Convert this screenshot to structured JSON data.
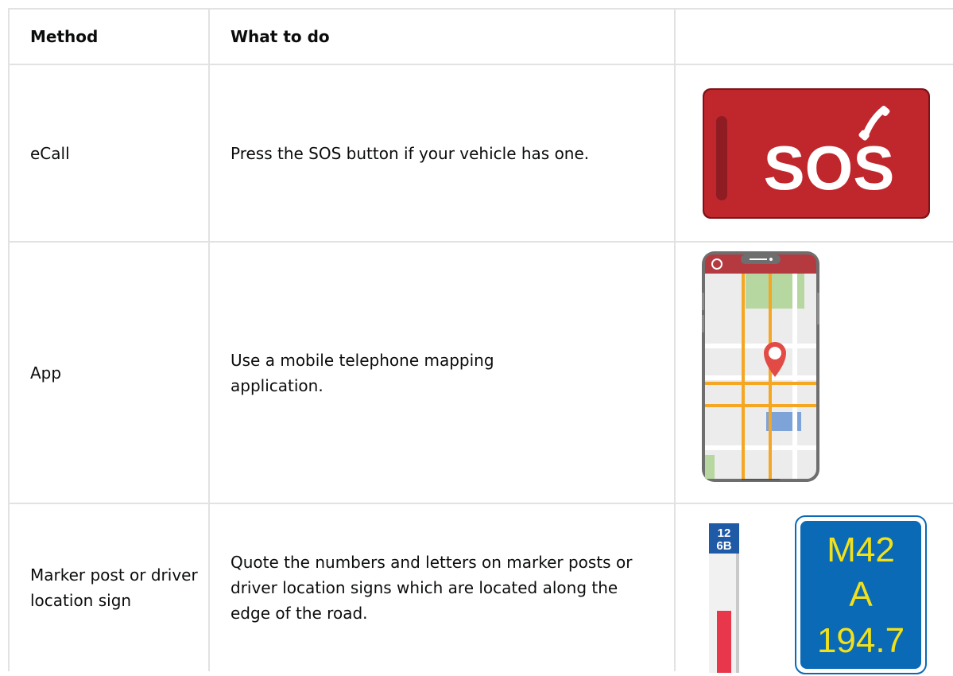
{
  "table": {
    "headers": {
      "method": "Method",
      "what": "What to do",
      "image": ""
    },
    "rows": [
      {
        "method": "eCall",
        "what": "Press the SOS button if your vehicle has one.",
        "image": "sos-button"
      },
      {
        "method": "App",
        "what": "Use a mobile telephone mapping application.",
        "image": "phone-map"
      },
      {
        "method": "Marker post or driver location sign",
        "what": "Quote the numbers and letters on marker posts or driver location signs which are located along the edge of the road.",
        "image": "marker-post-and-location-sign"
      }
    ]
  },
  "sos_button": {
    "label": "SOS",
    "icon": "phone-handset-icon",
    "color": "#c0272d"
  },
  "phone_map": {
    "icon": "location-pin-icon",
    "header_color": "#b53a3f",
    "road_color": "#f5a623"
  },
  "marker_post": {
    "line1": "12",
    "line2": "6B",
    "color": "#1f5aa6",
    "reflector": "#e8374a"
  },
  "location_sign": {
    "line1": "M42",
    "line2": "A",
    "line3": "194.7",
    "bg": "#0a6ab6",
    "text_color": "#f2e11a"
  }
}
